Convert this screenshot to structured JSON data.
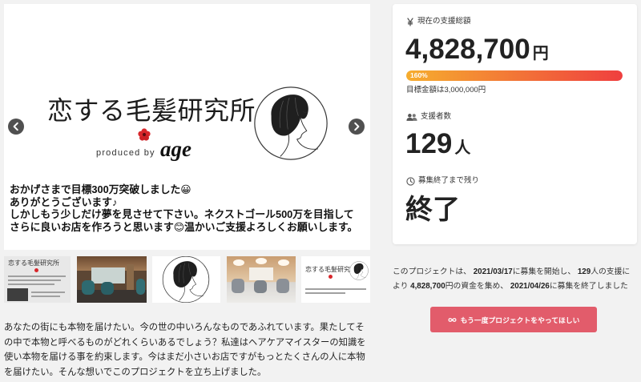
{
  "colors": {
    "accent": "#e25c6b",
    "progress_start": "#f6ad2e",
    "progress_end": "#ef3f3f"
  },
  "gallery": {
    "logo": {
      "title": "恋する毛髪研究所",
      "produced_by": "produced by",
      "brand": "age"
    },
    "caption_lines": [
      "おかげさまで目標300万突破しました😀",
      "ありがとうございます♪",
      "しかしもう少しだけ夢を見させて下さい。ネクストゴール500万を目指して",
      "さらに良いお店を作ろうと思います😊温かいご支援よろしくお願いします。"
    ],
    "prev_icon": "chevron-left-icon",
    "next_icon": "chevron-right-icon",
    "thumbnails": [
      {
        "logo_text": "恋する毛髪研究所"
      },
      {},
      {},
      {},
      {
        "logo_text": "恋する毛髪研究所"
      }
    ]
  },
  "description": {
    "lines": [
      "あなたの街にも本物を届けたい。今の世の中いろんなものであふれています。果たしてそ",
      "の中で本物と呼べるものがどれくらいあるでしょう？私達はヘアケアマイスターの知識を",
      "使い本物を届ける事を約束します。今はまだ小さいお店ですがもっとたくさんの人に本物",
      "を届けたい。そんな想いでこのプロジェクトを立ち上げました。"
    ]
  },
  "stats": {
    "total": {
      "icon": "yen-icon",
      "label": "現在の支援総額",
      "amount": "4,828,700",
      "unit": "円",
      "progress_percent": 160,
      "progress_label": "160%",
      "goal_text": "目標金額は3,000,000円"
    },
    "supporters": {
      "icon": "people-icon",
      "label": "支援者数",
      "count": "129",
      "unit": "人"
    },
    "remaining": {
      "icon": "clock-icon",
      "label": "募集終了まで残り",
      "value": "終了"
    }
  },
  "summary": {
    "line1": [
      "このプロジェクトは、 ",
      "2021/03/17",
      "に募集を開始し、 ",
      "129",
      "人の支援に"
    ],
    "line2": [
      "より ",
      "4,828,700",
      "円の資金を集め、 ",
      "2021/04/26",
      "に募集を終了しました"
    ]
  },
  "cta": {
    "icon": "infinity-icon",
    "label": "もう一度プロジェクトをやってほしい"
  }
}
